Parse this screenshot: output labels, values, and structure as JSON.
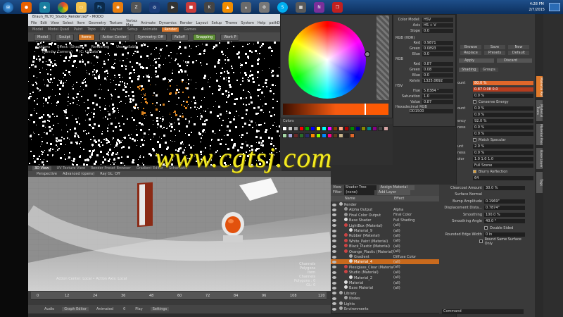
{
  "taskbar": {
    "icons": [
      "windows-start",
      "firefox",
      "modo",
      "chrome",
      "explorer",
      "photoshop",
      "blender",
      "zbrush",
      "cinema4d",
      "media",
      "folder",
      "keyshot",
      "vlc",
      "cone",
      "settings",
      "skype",
      "calculator",
      "onenote",
      "cube"
    ],
    "time": "4:28 PM",
    "date": "2/7/2015"
  },
  "window": {
    "title": "Braun_HL70_Studio_Render.lxo* - MODO",
    "menu": [
      "File",
      "Edit",
      "View",
      "Select",
      "Item",
      "Geometry",
      "Texture",
      "Vertex Map",
      "Animate",
      "Dynamics",
      "Render",
      "Layout",
      "Setup",
      "Theme",
      "System",
      "Help",
      "pathDuplicate"
    ]
  },
  "tabs": [
    "Model",
    "Model Quad",
    "Paint",
    "Topo",
    "UV",
    "Layout",
    "Setup",
    "Animate",
    "Render",
    "Games"
  ],
  "toolbar": {
    "items": [
      "Model",
      "Sculpt",
      "Items",
      "Action Center",
      "Symmetry: Off",
      "Falloff",
      "Snapping",
      "Work P"
    ]
  },
  "render_options": [
    "Options",
    "Effect: (Shadi...",
    "Rendering",
    "Unscrollable"
  ],
  "render_options2": [
    "(Render Camera)",
    "IC: Update"
  ],
  "view_tabs": [
    "3D View",
    "UV Texture View",
    "Render Preset Browser",
    "Gradient Editor",
    "Schematic"
  ],
  "viewport3d_bar": [
    "Perspective",
    "Advanced (opens)",
    "Ray GL: Off"
  ],
  "status": {
    "action_center": "Action Center: Local • Action Axis: Local",
    "info_lines": [
      "Channels",
      "Polygons",
      "Item",
      "Channels",
      "Polygons : 0",
      "GL: 0"
    ]
  },
  "timeline": {
    "ticks": [
      "0",
      "12",
      "24",
      "36",
      "48",
      "60",
      "72",
      "84",
      "96",
      "108",
      "120"
    ],
    "transport": [
      "Audio",
      "Graph Editor",
      "Animated",
      "0",
      "Play",
      "Settings"
    ]
  },
  "color_picker": {
    "header": [
      "Color Model:",
      "HSV",
      "Axis",
      "HS + V",
      "Slope",
      "0.0"
    ],
    "rgb_hdr_title": "RGB (HDR)",
    "rgb_hdr": [
      [
        "Red",
        "0.9871"
      ],
      [
        "Green",
        "0.0893"
      ],
      [
        "Blue",
        "0.0"
      ]
    ],
    "rgb_title": "RGB",
    "rgb": [
      [
        "Red",
        "0.87"
      ],
      [
        "Green",
        "0.08"
      ],
      [
        "Blue",
        "0.0"
      ]
    ],
    "kelvin_label": "Kelvin",
    "kelvin": "1325.0692",
    "hsv_title": "HSV",
    "hsv": [
      [
        "Hue",
        "5.8384 °"
      ],
      [
        "Saturation",
        "1.0"
      ],
      [
        "Value",
        "0.87"
      ]
    ],
    "hex_label": "Hexadecimal RGB",
    "hex": "DD1500",
    "swatch_tab": "Colors"
  },
  "right_panel": {
    "header_buttons": [
      "Browse",
      "Save",
      "New",
      "Replace",
      "Presets",
      "Default"
    ],
    "apply": "Apply",
    "discard": "Discard",
    "tabs_top": [
      "Shading",
      "Groups"
    ],
    "rows": [
      {
        "lbl": "ount",
        "val": "80.0 %",
        "style": "orange"
      },
      {
        "lbl": "",
        "val": "0.87      0.08      0.0",
        "style": "dark"
      },
      {
        "lbl": "",
        "val": "0.0 %",
        "style": ""
      },
      {
        "lbl": "",
        "val": "Conserve Energy",
        "style": "check"
      },
      {
        "lbl": "ount",
        "val": "0.0 %",
        "style": ""
      },
      {
        "lbl": "",
        "val": "0.0 %",
        "style": ""
      },
      {
        "lbl": "ency",
        "val": "92.0 %",
        "style": ""
      },
      {
        "lbl": "ness",
        "val": "0.0 %",
        "style": ""
      },
      {
        "lbl": "",
        "val": "0.0 %",
        "style": ""
      },
      {
        "lbl": "",
        "val": "Match Specular",
        "style": "check"
      },
      {
        "lbl": "unt",
        "val": "2.0 %",
        "style": ""
      },
      {
        "lbl": "ness",
        "val": "0.0 %",
        "style": ""
      },
      {
        "lbl": "olor",
        "val": "1.0       1.0       1.0",
        "style": ""
      },
      {
        "lbl": "",
        "val": "Full Scene",
        "style": ""
      },
      {
        "lbl": "",
        "val": "Blurry Reflection",
        "style": "checkon"
      },
      {
        "lbl": "",
        "val": "64",
        "style": ""
      }
    ],
    "side_tabs": [
      "Material Ref",
      "Material Trans",
      "Material Pass",
      "Base Layer",
      "Tags"
    ],
    "side_tab_active": "Material Ref"
  },
  "shader_tree": {
    "view_label": "View",
    "view_value": "Shader Tree",
    "filter_label": "Filter",
    "filter_value": "(none)",
    "assign": "Assign Material",
    "add_layer": "Add Layer",
    "col_name": "Name",
    "col_effect": "Effect",
    "rows": [
      {
        "name": "Render",
        "effect": "",
        "indent": 0,
        "color": "#bbb",
        "sel": false
      },
      {
        "name": "Alpha Output",
        "effect": "Alpha",
        "indent": 1,
        "color": "#999",
        "sel": false
      },
      {
        "name": "Final Color Output",
        "effect": "Final Color",
        "indent": 1,
        "color": "#999",
        "sel": false
      },
      {
        "name": "Base Shader",
        "effect": "Full Shading",
        "indent": 1,
        "color": "#ddd",
        "sel": false
      },
      {
        "name": "LightBox (Material)",
        "effect": "(all)",
        "indent": 1,
        "color": "#cc4444",
        "sel": false
      },
      {
        "name": "Material_9",
        "effect": "(all)",
        "indent": 2,
        "color": "#ddd",
        "sel": false
      },
      {
        "name": "Rubber (Material)",
        "effect": "(all)",
        "indent": 1,
        "color": "#cc4444",
        "sel": false
      },
      {
        "name": "White_Paint (Material)",
        "effect": "(all)",
        "indent": 1,
        "color": "#cc4444",
        "sel": false
      },
      {
        "name": "Black_Plastic (Material)",
        "effect": "(all)",
        "indent": 1,
        "color": "#cc4444",
        "sel": false
      },
      {
        "name": "Orange_Plastic (Material)",
        "effect": "(all)",
        "indent": 1,
        "color": "#cc4444",
        "sel": false
      },
      {
        "name": "Gradient",
        "effect": "Diffuse Color",
        "indent": 2,
        "color": "#aaa",
        "sel": false
      },
      {
        "name": "Material_4",
        "effect": "(all)",
        "indent": 2,
        "color": "#ddd",
        "sel": true
      },
      {
        "name": "Plexiglass_Clear (Material)",
        "effect": "(all)",
        "indent": 1,
        "color": "#cc4444",
        "sel": false
      },
      {
        "name": "Studio (Material)",
        "effect": "(all)",
        "indent": 1,
        "color": "#cc4444",
        "sel": false
      },
      {
        "name": "Material_2",
        "effect": "(all)",
        "indent": 2,
        "color": "#ddd",
        "sel": false
      },
      {
        "name": "Material",
        "effect": "(all)",
        "indent": 1,
        "color": "#ddd",
        "sel": false
      },
      {
        "name": "Base Material",
        "effect": "(all)",
        "indent": 1,
        "color": "#ddd",
        "sel": false
      },
      {
        "name": "Library",
        "effect": "",
        "indent": 0,
        "color": "#aaa",
        "sel": false
      },
      {
        "name": "Nodes",
        "effect": "",
        "indent": 1,
        "color": "#aaa",
        "sel": false
      },
      {
        "name": "Lights",
        "effect": "",
        "indent": 0,
        "color": "#aaa",
        "sel": false
      },
      {
        "name": "Environments",
        "effect": "",
        "indent": 0,
        "color": "#aaa",
        "sel": false
      }
    ]
  },
  "material_props": {
    "rows": [
      {
        "lbl": "Clearcoat Amount",
        "val": "30.0 %"
      },
      {
        "lbl": "Surface Normal",
        "val": ""
      },
      {
        "lbl": "Bump Amplitude",
        "val": "0.1969\""
      },
      {
        "lbl": "Displacement Dista...",
        "val": "0.7874\""
      },
      {
        "lbl": "Smoothing",
        "val": "100.0 %"
      },
      {
        "lbl": "Smoothing Angle",
        "val": "40.0 °"
      },
      {
        "lbl": "",
        "val": "Double Sided"
      },
      {
        "lbl": "Rounded Edge Width",
        "val": "0 in"
      },
      {
        "lbl": "",
        "val": "Round Same Surface Only"
      }
    ],
    "command": "Command"
  },
  "watermark": "www.cgtsj.com",
  "colors": {
    "accent": "#e07a2a",
    "selected": "#c96a1d",
    "watermark": "#f3ea22",
    "picked": "#dd1500"
  }
}
